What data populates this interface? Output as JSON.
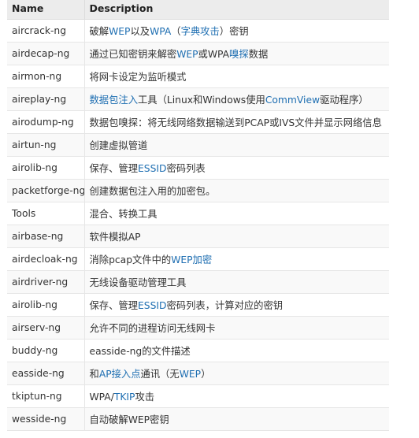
{
  "headers": {
    "name": "Name",
    "description": "Description"
  },
  "colors": {
    "link": "#1f6fb2",
    "header_bg": "#ececec",
    "border": "#e6e6e6"
  },
  "rows": [
    {
      "name": "aircrack-ng",
      "desc": [
        {
          "t": "破解"
        },
        {
          "t": "WEP",
          "link": true
        },
        {
          "t": "以及"
        },
        {
          "t": "WPA",
          "link": true
        },
        {
          "t": "（"
        },
        {
          "t": "字典攻击",
          "link": true
        },
        {
          "t": "）密钥"
        }
      ]
    },
    {
      "name": "airdecap-ng",
      "desc": [
        {
          "t": "通过已知密钥来解密"
        },
        {
          "t": "WEP",
          "link": true
        },
        {
          "t": "或WPA"
        },
        {
          "t": "嗅探",
          "link": true
        },
        {
          "t": "数据"
        }
      ]
    },
    {
      "name": "airmon-ng",
      "desc": [
        {
          "t": "将网卡设定为监听模式"
        }
      ]
    },
    {
      "name": "aireplay-ng",
      "desc": [
        {
          "t": "数据包注入",
          "link": true
        },
        {
          "t": "工具（Linux和Windows使用"
        },
        {
          "t": "CommView",
          "link": true
        },
        {
          "t": "驱动程序）"
        }
      ]
    },
    {
      "name": "airodump-ng",
      "desc": [
        {
          "t": "数据包嗅探：将无线网络数据输送到PCAP或IVS文件并显示网络信息"
        }
      ]
    },
    {
      "name": "airtun-ng",
      "desc": [
        {
          "t": "创建虚拟管道"
        }
      ]
    },
    {
      "name": "airolib-ng",
      "desc": [
        {
          "t": "保存、管理"
        },
        {
          "t": "ESSID",
          "link": true
        },
        {
          "t": "密码列表"
        }
      ]
    },
    {
      "name": "packetforge-ng",
      "desc": [
        {
          "t": "创建数据包注入用的加密包。"
        }
      ]
    },
    {
      "name": "Tools",
      "desc": [
        {
          "t": "混合、转换工具"
        }
      ]
    },
    {
      "name": "airbase-ng",
      "desc": [
        {
          "t": "软件模拟AP"
        }
      ]
    },
    {
      "name": "airdecloak-ng",
      "desc": [
        {
          "t": "消除pcap文件中的"
        },
        {
          "t": "WEP加密",
          "link": true
        }
      ]
    },
    {
      "name": "airdriver-ng",
      "desc": [
        {
          "t": "无线设备驱动管理工具"
        }
      ]
    },
    {
      "name": "airolib-ng",
      "desc": [
        {
          "t": "保存、管理"
        },
        {
          "t": "ESSID",
          "link": true
        },
        {
          "t": "密码列表，计算对应的密钥"
        }
      ]
    },
    {
      "name": "airserv-ng",
      "desc": [
        {
          "t": "允许不同的进程访问无线网卡"
        }
      ]
    },
    {
      "name": "buddy-ng",
      "desc": [
        {
          "t": "easside-ng的文件描述"
        }
      ]
    },
    {
      "name": "easside-ng",
      "desc": [
        {
          "t": "和"
        },
        {
          "t": "AP接入点",
          "link": true
        },
        {
          "t": "通讯（无"
        },
        {
          "t": "WEP",
          "link": true
        },
        {
          "t": "）"
        }
      ]
    },
    {
      "name": "tkiptun-ng",
      "desc": [
        {
          "t": "WPA/"
        },
        {
          "t": "TKIP",
          "link": true
        },
        {
          "t": "攻击"
        }
      ]
    },
    {
      "name": "wesside-ng",
      "desc": [
        {
          "t": "自动破解WEP密钥"
        }
      ]
    }
  ]
}
